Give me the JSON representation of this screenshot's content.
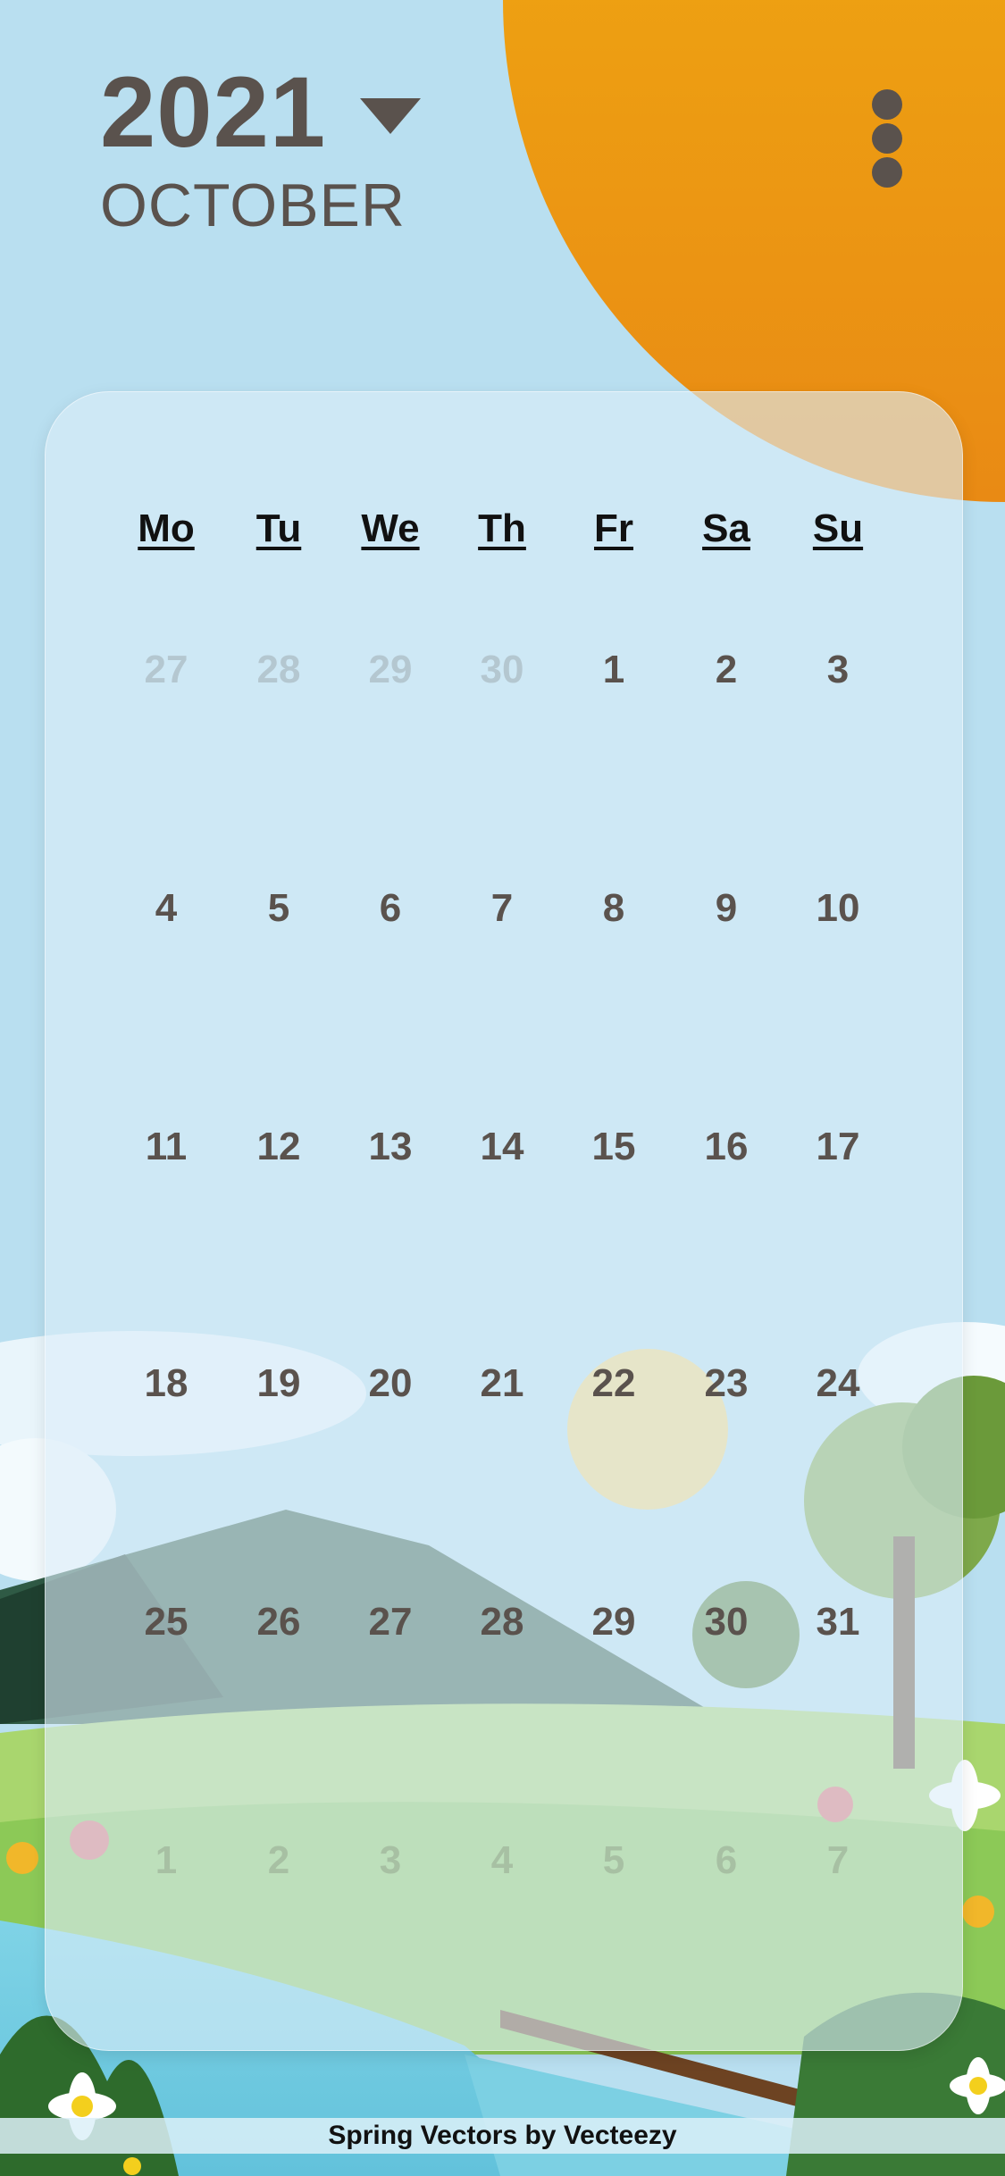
{
  "header": {
    "year": "2021",
    "month": "OCTOBER"
  },
  "calendar": {
    "weekdays": [
      "Mo",
      "Tu",
      "We",
      "Th",
      "Fr",
      "Sa",
      "Su"
    ],
    "weeks": [
      [
        {
          "d": "27",
          "other": true
        },
        {
          "d": "28",
          "other": true
        },
        {
          "d": "29",
          "other": true
        },
        {
          "d": "30",
          "other": true
        },
        {
          "d": "1"
        },
        {
          "d": "2"
        },
        {
          "d": "3"
        }
      ],
      [
        {
          "d": "4"
        },
        {
          "d": "5"
        },
        {
          "d": "6"
        },
        {
          "d": "7"
        },
        {
          "d": "8"
        },
        {
          "d": "9"
        },
        {
          "d": "10"
        }
      ],
      [
        {
          "d": "11"
        },
        {
          "d": "12"
        },
        {
          "d": "13"
        },
        {
          "d": "14"
        },
        {
          "d": "15"
        },
        {
          "d": "16"
        },
        {
          "d": "17"
        }
      ],
      [
        {
          "d": "18"
        },
        {
          "d": "19"
        },
        {
          "d": "20"
        },
        {
          "d": "21"
        },
        {
          "d": "22"
        },
        {
          "d": "23"
        },
        {
          "d": "24"
        }
      ],
      [
        {
          "d": "25"
        },
        {
          "d": "26"
        },
        {
          "d": "27"
        },
        {
          "d": "28"
        },
        {
          "d": "29"
        },
        {
          "d": "30"
        },
        {
          "d": "31"
        }
      ],
      [
        {
          "d": "1",
          "other": true
        },
        {
          "d": "2",
          "other": true
        },
        {
          "d": "3",
          "other": true
        },
        {
          "d": "4",
          "other": true
        },
        {
          "d": "5",
          "other": true
        },
        {
          "d": "6",
          "other": true
        },
        {
          "d": "7",
          "other": true
        }
      ]
    ]
  },
  "footer": {
    "credit": "Spring Vectors by Vecteezy"
  },
  "icons": {
    "year_dropdown": "caret-down-icon",
    "menu": "more-vertical-icon"
  },
  "colors": {
    "sky": "#b9dff0",
    "sun": "#f0a414",
    "text": "#5a524d"
  }
}
